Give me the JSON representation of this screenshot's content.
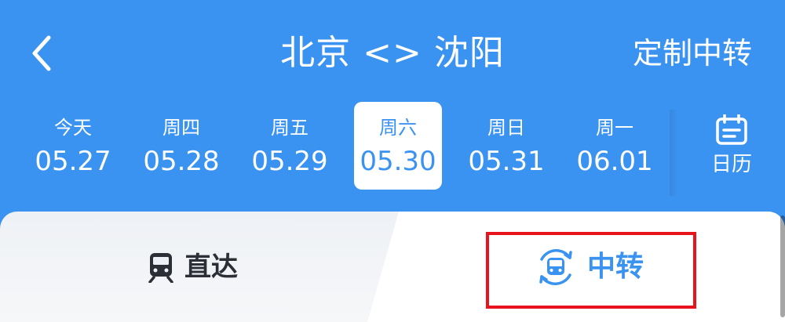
{
  "header": {
    "title": "北京 <> 沈阳",
    "custom_transfer_label": "定制中转"
  },
  "dates": [
    {
      "weekday": "今天",
      "date": "05.27",
      "selected": false
    },
    {
      "weekday": "周四",
      "date": "05.28",
      "selected": false
    },
    {
      "weekday": "周五",
      "date": "05.29",
      "selected": false
    },
    {
      "weekday": "周六",
      "date": "05.30",
      "selected": true
    },
    {
      "weekday": "周日",
      "date": "05.31",
      "selected": false
    },
    {
      "weekday": "周一",
      "date": "06.01",
      "selected": false
    }
  ],
  "calendar": {
    "label": "日历",
    "icon": "calendar-icon"
  },
  "tabs": {
    "direct": {
      "label": "直达",
      "icon": "train-icon",
      "active": false
    },
    "transfer": {
      "label": "中转",
      "icon": "train-transfer-icon",
      "active": true
    }
  },
  "colors": {
    "primary": "#3b93f1",
    "highlight": "#e8141b",
    "text_dark": "#2c2f36"
  }
}
